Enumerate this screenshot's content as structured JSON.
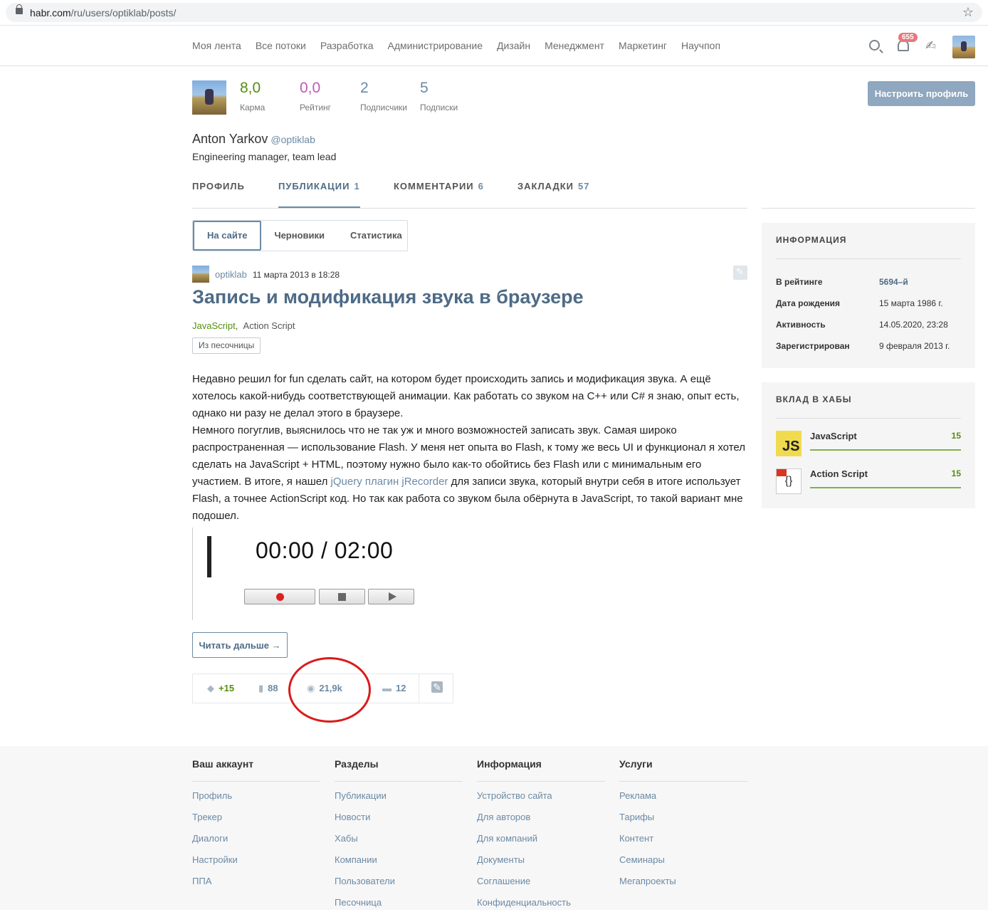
{
  "browser": {
    "url_host": "habr.com",
    "url_path": "/ru/users/optiklab/posts/"
  },
  "nav": {
    "items": [
      "Моя лента",
      "Все потоки",
      "Разработка",
      "Администрирование",
      "Дизайн",
      "Менеджмент",
      "Маркетинг",
      "Научпоп"
    ],
    "notifications_count": "655"
  },
  "profile": {
    "karma": "8,0",
    "karma_label": "Карма",
    "rating": "0,0",
    "rating_label": "Рейтинг",
    "subscribers": "2",
    "subscribers_label": "Подписчики",
    "subscriptions": "5",
    "subscriptions_label": "Подписки",
    "setup_button": "Настроить профиль",
    "name": "Anton Yarkov",
    "nick": "@optiklab",
    "title": "Engineering manager, team lead"
  },
  "tabs": [
    {
      "label": "ПРОФИЛЬ",
      "count": ""
    },
    {
      "label": "ПУБЛИКАЦИИ",
      "count": "1"
    },
    {
      "label": "КОММЕНТАРИИ",
      "count": "6"
    },
    {
      "label": "ЗАКЛАДКИ",
      "count": "57"
    }
  ],
  "subtabs": [
    "На сайте",
    "Черновики",
    "Статистика"
  ],
  "post": {
    "author": "optiklab",
    "date": "11 марта 2013 в 18:28",
    "title": "Запись и модификация звука в браузере",
    "hub1": "JavaScript",
    "hub2": "Action Script",
    "sandbox": "Из песочницы",
    "p1": "Недавно решил for fun сделать сайт, на котором будет происходить запись и модификация звука. А ещё хотелось какой-нибудь соответствующей анимации. Как работать со звуком на С++ или C# я знаю, опыт есть, однако ни разу не делал этого в браузере.",
    "p2a": "Немного погуглив, выяснилось что не так уж и много возможностей записать звук. Самая широко распространенная — использование Flash. У меня нет опыта во Flash, к тому же весь UI и функционал я хотел сделать на JavaScript + HTML, поэтому нужно было как-то обойтись без Flash или с минимальным его участием. В итоге, я нашел ",
    "p2link": "jQuery плагин jRecorder",
    "p2b": " для записи звука, который внутри себя в итоге использует Flash, а точнее ActionScript код. Но так как работа со звуком была обёрнута в JavaScript, то такой вариант мне подошел.",
    "recorder_time": "00:00 / 02:00",
    "read_more": "Читать дальше →",
    "score": "+15",
    "bookmarks": "88",
    "views": "21,9k",
    "comments": "12"
  },
  "sidebar": {
    "info_title": "ИНФОРМАЦИЯ",
    "info": [
      {
        "k": "В рейтинге",
        "v": "5694–й"
      },
      {
        "k": "Дата рождения",
        "v": "15 марта 1986 г."
      },
      {
        "k": "Активность",
        "v": "14.05.2020, 23:28"
      },
      {
        "k": "Зарегистрирован",
        "v": "9 февраля 2013 г."
      }
    ],
    "hubs_title": "ВКЛАД В ХАБЫ",
    "hubs": [
      {
        "name": "JavaScript",
        "value": "15",
        "icon_text": "JS"
      },
      {
        "name": "Action Script",
        "value": "15",
        "icon_text": "{}"
      }
    ]
  },
  "footer": [
    {
      "title": "Ваш аккаунт",
      "links": [
        "Профиль",
        "Трекер",
        "Диалоги",
        "Настройки",
        "ППА"
      ]
    },
    {
      "title": "Разделы",
      "links": [
        "Публикации",
        "Новости",
        "Хабы",
        "Компании",
        "Пользователи",
        "Песочница"
      ]
    },
    {
      "title": "Информация",
      "links": [
        "Устройство сайта",
        "Для авторов",
        "Для компаний",
        "Документы",
        "Соглашение",
        "Конфиденциальность"
      ]
    },
    {
      "title": "Услуги",
      "links": [
        "Реклама",
        "Тарифы",
        "Контент",
        "Семинары",
        "Мегапроекты"
      ]
    }
  ],
  "colors": {
    "accent": "#6b8aa5",
    "title": "#4e6b86",
    "green": "#548e0f",
    "rating_pink": "#c159b5",
    "highlight_circle": "#d81c1c"
  }
}
